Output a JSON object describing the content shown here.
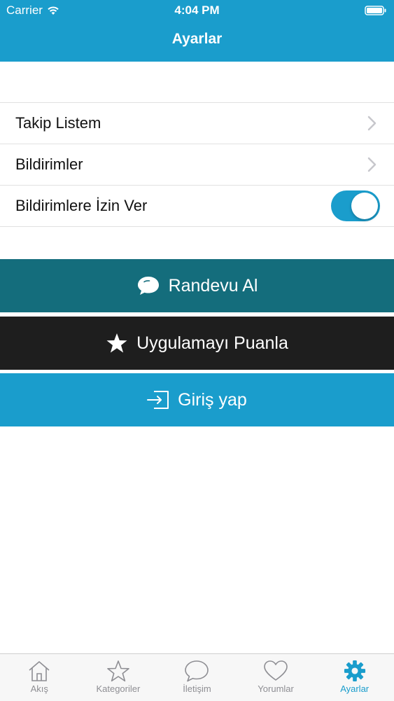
{
  "status_bar": {
    "carrier": "Carrier",
    "time": "4:04 PM"
  },
  "header": {
    "title": "Ayarlar"
  },
  "settings": {
    "rows": [
      {
        "label": "Takip Listem"
      },
      {
        "label": "Bildirimler"
      },
      {
        "label": "Bildirimlere İzin Ver",
        "toggle_on": true
      }
    ]
  },
  "actions": {
    "randevu_label": "Randevu Al",
    "puanla_label": "Uygulamayı Puanla",
    "giris_label": "Giriş yap"
  },
  "colors": {
    "primary": "#1a9dcc",
    "randevu": "#146d7c",
    "puanla": "#1e1e1e"
  },
  "tabbar": {
    "tabs": [
      {
        "label": "Akış",
        "icon": "home-icon"
      },
      {
        "label": "Kategoriler",
        "icon": "star-icon"
      },
      {
        "label": "İletişim",
        "icon": "chat-icon"
      },
      {
        "label": "Yorumlar",
        "icon": "heart-icon"
      },
      {
        "label": "Ayarlar",
        "icon": "gear-icon",
        "active": true
      }
    ]
  }
}
